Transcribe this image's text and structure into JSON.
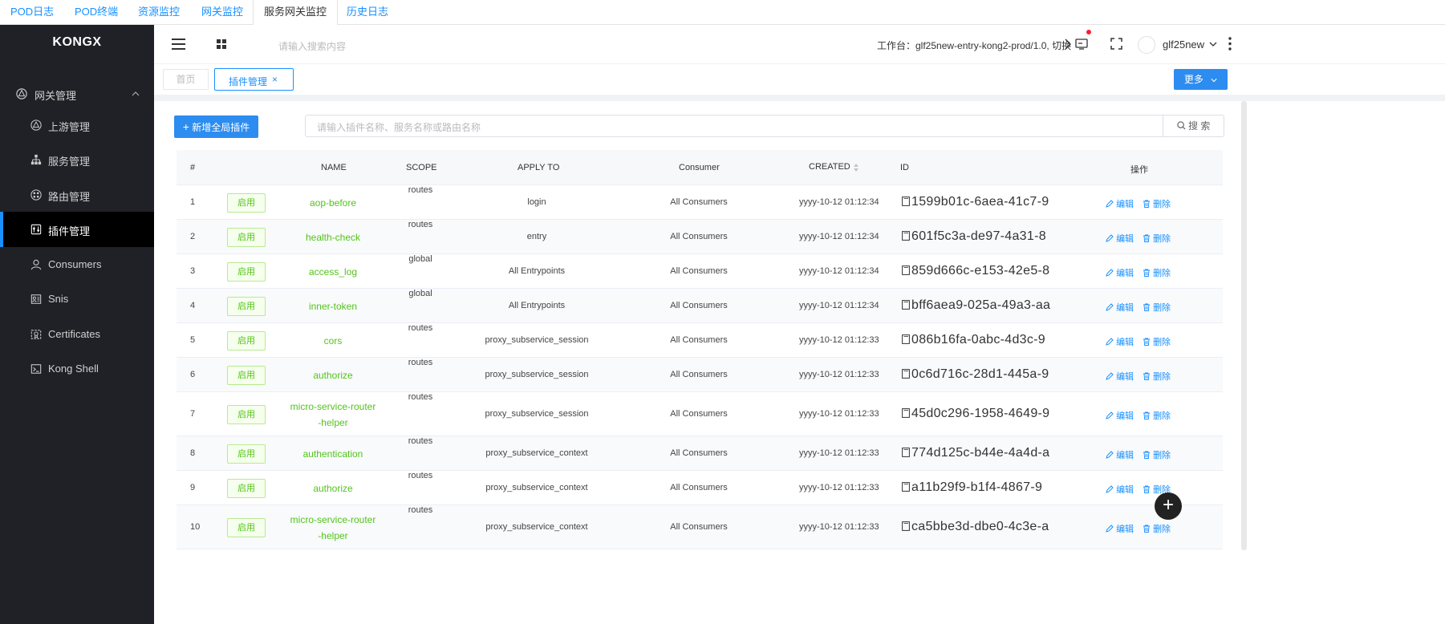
{
  "top_tabs": [
    "POD日志",
    "POD终端",
    "资源监控",
    "网关监控",
    "服务网关监控",
    "历史日志"
  ],
  "sidebar": {
    "logo": "KONGX",
    "group": "网关管理",
    "items": [
      {
        "label": "上游管理",
        "icon": "upstream-icon"
      },
      {
        "label": "服务管理",
        "icon": "service-tree-icon"
      },
      {
        "label": "路由管理",
        "icon": "route-icon"
      },
      {
        "label": "插件管理",
        "icon": "plugin-icon",
        "active": true
      },
      {
        "label": "Consumers",
        "icon": "user-icon"
      },
      {
        "label": "Snis",
        "icon": "sni-icon"
      },
      {
        "label": "Certificates",
        "icon": "certificate-icon"
      },
      {
        "label": "Kong Shell",
        "icon": "terminal-icon"
      }
    ]
  },
  "header": {
    "search_placeholder": "请输入搜索内容",
    "workspace": "工作台：glf25new-entry-kong2-prod/1.0, 切换",
    "username": "glf25new"
  },
  "tags": {
    "home": "首页",
    "current": "插件管理",
    "more": "更多"
  },
  "toolbar": {
    "add_button": "新增全局插件",
    "search_placeholder": "请输入插件名称、服务名称或路由名称",
    "search_button": "搜 索"
  },
  "table": {
    "headers": {
      "num": "#",
      "name": "NAME",
      "scope": "SCOPE",
      "apply": "APPLY TO",
      "consumer": "Consumer",
      "created": "CREATED",
      "id": "ID",
      "actions": "操作"
    },
    "action_edit": "编辑",
    "action_delete": "删除",
    "rows": [
      {
        "num": "1",
        "status": "启用",
        "name": [
          "aop-before"
        ],
        "scope": "routes",
        "apply": "login",
        "consumer": "All Consumers",
        "created": "yyyy-10-12 01:12:34",
        "id": "1599b01c-6aea-41c7-9"
      },
      {
        "num": "2",
        "status": "启用",
        "name": [
          "health-check"
        ],
        "scope": "routes",
        "apply": "entry",
        "consumer": "All Consumers",
        "created": "yyyy-10-12 01:12:34",
        "id": "601f5c3a-de97-4a31-8"
      },
      {
        "num": "3",
        "status": "启用",
        "name": [
          "access_log"
        ],
        "scope": "global",
        "apply": "All Entrypoints",
        "consumer": "All Consumers",
        "created": "yyyy-10-12 01:12:34",
        "id": "859d666c-e153-42e5-8"
      },
      {
        "num": "4",
        "status": "启用",
        "name": [
          "inner-token"
        ],
        "scope": "global",
        "apply": "All Entrypoints",
        "consumer": "All Consumers",
        "created": "yyyy-10-12 01:12:34",
        "id": "bff6aea9-025a-49a3-aa"
      },
      {
        "num": "5",
        "status": "启用",
        "name": [
          "cors"
        ],
        "scope": "routes",
        "apply": "proxy_subservice_session",
        "consumer": "All Consumers",
        "created": "yyyy-10-12 01:12:33",
        "id": "086b16fa-0abc-4d3c-9"
      },
      {
        "num": "6",
        "status": "启用",
        "name": [
          "authorize"
        ],
        "scope": "routes",
        "apply": "proxy_subservice_session",
        "consumer": "All Consumers",
        "created": "yyyy-10-12 01:12:33",
        "id": "0c6d716c-28d1-445a-9"
      },
      {
        "num": "7",
        "status": "启用",
        "name": [
          "micro-service-router",
          "-helper"
        ],
        "scope": "routes",
        "apply": "proxy_subservice_session",
        "consumer": "All Consumers",
        "created": "yyyy-10-12 01:12:33",
        "id": "45d0c296-1958-4649-9"
      },
      {
        "num": "8",
        "status": "启用",
        "name": [
          "authentication"
        ],
        "scope": "routes",
        "apply": "proxy_subservice_context",
        "consumer": "All Consumers",
        "created": "yyyy-10-12 01:12:33",
        "id": "774d125c-b44e-4a4d-a"
      },
      {
        "num": "9",
        "status": "启用",
        "name": [
          "authorize"
        ],
        "scope": "routes",
        "apply": "proxy_subservice_context",
        "consumer": "All Consumers",
        "created": "yyyy-10-12 01:12:33",
        "id": "a11b29f9-b1f4-4867-9"
      },
      {
        "num": "10",
        "status": "启用",
        "name": [
          "micro-service-router",
          "-helper"
        ],
        "scope": "routes",
        "apply": "proxy_subservice_context",
        "consumer": "All Consumers",
        "created": "yyyy-10-12 01:12:33",
        "id": "ca5bbe3d-dbe0-4c3e-a"
      }
    ]
  },
  "colors": {
    "accent": "#1890ff",
    "sidebar_bg": "#1f2127",
    "status_green": "#52c41a"
  }
}
